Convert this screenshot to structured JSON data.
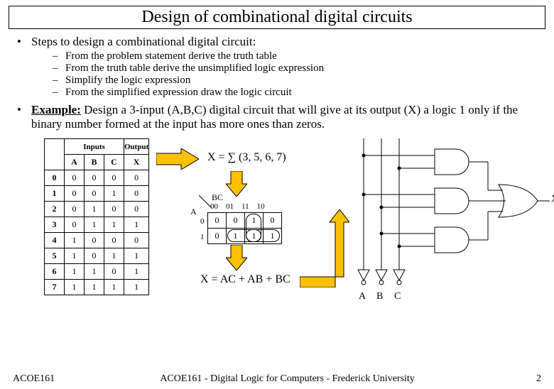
{
  "title": "Design of combinational digital circuits",
  "bullet1": "Steps to design a combinational digital circuit:",
  "sub": [
    "From the problem statement derive the truth table",
    "From the truth table derive the unsimplified logic expression",
    "Simplify the logic expression",
    "From the simplified expression draw the logic circuit"
  ],
  "example_label": "Example:",
  "example_text": " Design a 3-input (A,B,C) digital circuit that will give at its output (X) a logic 1 only if the binary number formed at the input has more ones than zeros.",
  "table": {
    "h_inputs": "Inputs",
    "h_output": "Output",
    "cols": [
      "A",
      "B",
      "C",
      "X"
    ],
    "rows": [
      [
        "0",
        "0",
        "0",
        "0",
        "0"
      ],
      [
        "1",
        "0",
        "0",
        "1",
        "0"
      ],
      [
        "2",
        "0",
        "1",
        "0",
        "0"
      ],
      [
        "3",
        "0",
        "1",
        "1",
        "1"
      ],
      [
        "4",
        "1",
        "0",
        "0",
        "0"
      ],
      [
        "5",
        "1",
        "0",
        "1",
        "1"
      ],
      [
        "6",
        "1",
        "1",
        "0",
        "1"
      ],
      [
        "7",
        "1",
        "1",
        "1",
        "1"
      ]
    ]
  },
  "sum_expr": "X = ∑ (3, 5, 6, 7)",
  "kmap": {
    "axis_bc": "BC",
    "axis_a": "A",
    "col_labels": [
      "00",
      "01",
      "11",
      "10"
    ],
    "row_labels": [
      "0",
      "1"
    ],
    "cells": [
      [
        "0",
        "0",
        "1",
        "0"
      ],
      [
        "0",
        "1",
        "1",
        "1"
      ]
    ]
  },
  "final_expr": "X = AC + AB + BC",
  "circuit": {
    "inputs": [
      "A",
      "B",
      "C"
    ],
    "output": "X"
  },
  "footer": {
    "left": "ACOE161",
    "mid": "ACOE161 - Digital Logic for Computers - Frederick University",
    "page": "2"
  }
}
